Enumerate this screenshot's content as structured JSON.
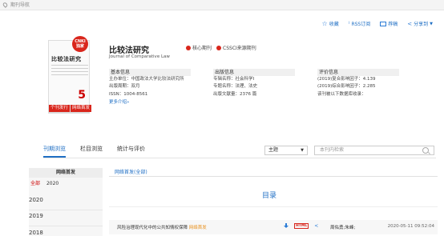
{
  "breadcrumb": "期刊导航",
  "actions": {
    "favorite": "收藏",
    "rss": "RSS订阅",
    "email": "荐稿",
    "share": "分享到"
  },
  "journal": {
    "title": "比较法研究",
    "subtitle": "Journal of Comparative Law",
    "cover_title": "比较法研究",
    "cover_issue": "5",
    "badge": "CNKI 独家",
    "btn1": "个刊发行",
    "btn2": "网络首发",
    "tag1": "核心期刊",
    "tag2": "CSSCI来源期刊"
  },
  "basic": {
    "head": "基本信息",
    "lines": [
      "主办单位：中国政法大学比较法研究所",
      "出版周期：双月",
      "ISSN：1004-8561"
    ],
    "more": "更多介绍»"
  },
  "publish": {
    "head": "出版信息",
    "lines": [
      "专辑名称：社会科学I",
      "专题名称：法理、法史",
      "出版文献量：2376 篇"
    ]
  },
  "eval": {
    "head": "评价信息",
    "lines": [
      "(2019)复合影响因子：4.139",
      "(2019)综合影响因子：2.285",
      "该刊被以下数据库收录："
    ]
  },
  "tabs": [
    "刊期浏览",
    "栏目浏览",
    "统计与评价"
  ],
  "search": {
    "select": "主题",
    "placeholder": "本刊内检索"
  },
  "left": {
    "head": "网络首发",
    "row_label": "全部",
    "row_year": "2020",
    "years": [
      "2020",
      "2019",
      "2018"
    ]
  },
  "subtab": "网络首发(全部)",
  "mulu": "目录",
  "article": {
    "title": "风险治理现代化中的公共知情权保障",
    "tag": "网络首发",
    "author": "周佑勇;朱峰;",
    "date": "2020-05-11 09:52:04"
  }
}
